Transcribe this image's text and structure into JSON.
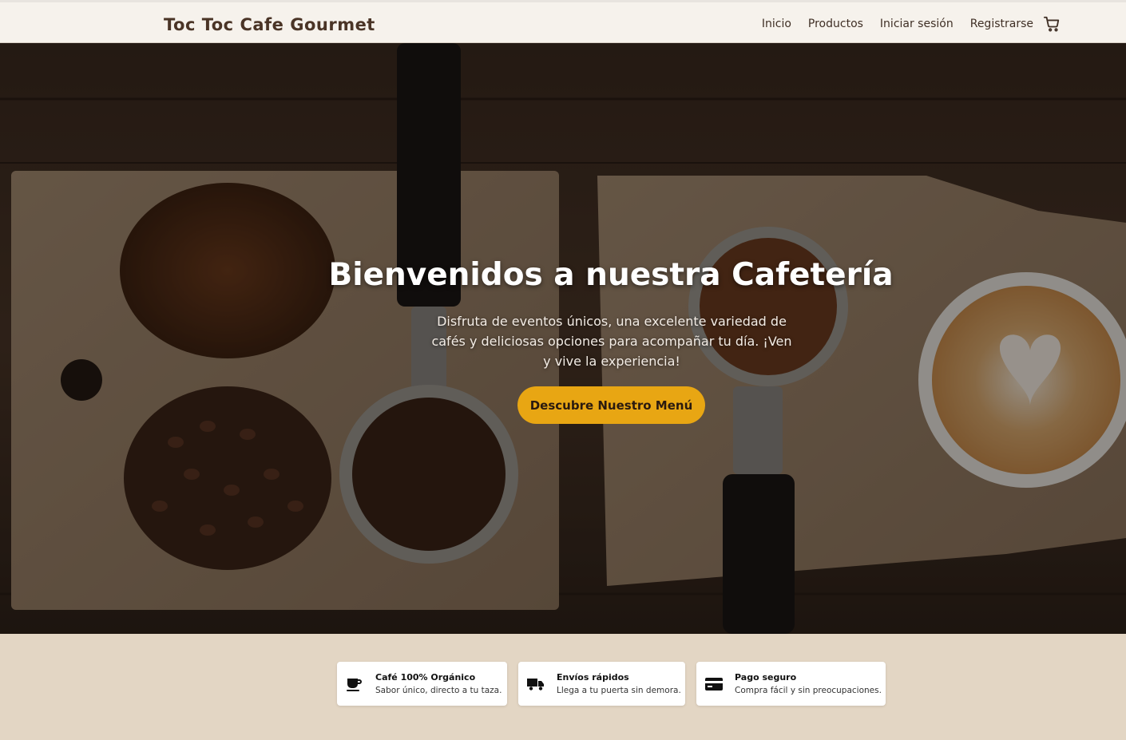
{
  "header": {
    "brand": "Toc Toc Cafe Gourmet",
    "nav": [
      {
        "label": "Inicio"
      },
      {
        "label": "Productos"
      },
      {
        "label": "Iniciar sesión"
      },
      {
        "label": "Registrarse"
      }
    ],
    "cart_icon": "cart-icon"
  },
  "hero": {
    "title": "Bienvenidos a nuestra Cafetería",
    "subtitle": "Disfruta de eventos únicos, una excelente variedad de cafés y deliciosas opciones para acompañar tu día. ¡Ven y vive la experiencia!",
    "cta_label": "Descubre Nuestro Menú",
    "cta_color": "#e8a613"
  },
  "features": [
    {
      "icon": "coffee-cup-icon",
      "title": "Café 100% Orgánico",
      "text": "Sabor único, directo a tu taza."
    },
    {
      "icon": "truck-icon",
      "title": "Envíos rápidos",
      "text": "Llega a tu puerta sin demora."
    },
    {
      "icon": "credit-card-icon",
      "title": "Pago seguro",
      "text": "Compra fácil y sin preocupaciones."
    }
  ],
  "colors": {
    "navbar_bg": "#f6f2ec",
    "brand_text": "#4a3426",
    "page_bg": "#e3d6c4"
  }
}
